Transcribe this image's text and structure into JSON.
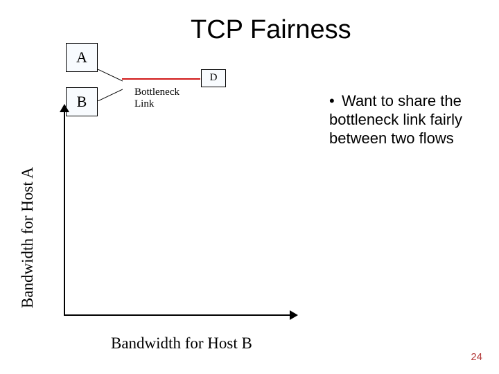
{
  "title": "TCP Fairness",
  "nodes": {
    "a": "A",
    "b": "B",
    "d": "D"
  },
  "bottleneck_label_line1": "Bottleneck",
  "bottleneck_label_line2": "Link",
  "axes": {
    "y": "Bandwidth for Host A",
    "x": "Bandwidth for Host B"
  },
  "bullet": "Want to share the bottleneck link fairly between two flows",
  "slide_number": "24",
  "chart_data": {
    "type": "line",
    "title": "TCP Fairness",
    "xlabel": "Bandwidth for Host B",
    "ylabel": "Bandwidth for Host A",
    "series": [],
    "xlim": null,
    "ylim": null
  }
}
